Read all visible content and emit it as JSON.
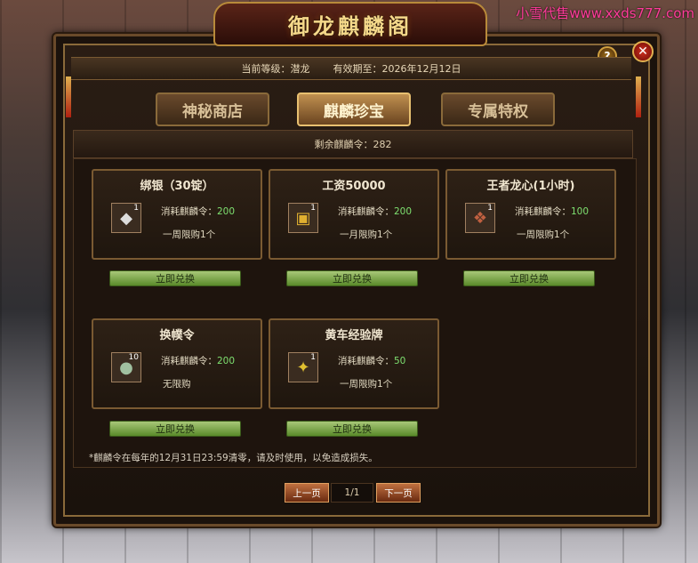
{
  "watermark": "小雪代售www.xxds777.com",
  "window": {
    "title": "御龙麒麟阁",
    "help_label": "?",
    "close_label": "✕",
    "level_label": "当前等级：潜龙",
    "valid_label": "有效期至：2026年12月12日"
  },
  "tabs": [
    {
      "label": "神秘商店",
      "active": false
    },
    {
      "label": "麒麟珍宝",
      "active": true
    },
    {
      "label": "专属特权",
      "active": false
    }
  ],
  "remaining": "剩余麒麟令：282",
  "items": [
    {
      "name": "绑银（30锭）",
      "qty": "1",
      "cost_label": "消耗麒麟令：",
      "cost": "200",
      "limit": "一周限购1个",
      "icon": "silver-ingot-icon",
      "button": "立即兑换"
    },
    {
      "name": "工资50000",
      "qty": "1",
      "cost_label": "消耗麒麟令：",
      "cost": "200",
      "limit": "一月限购1个",
      "icon": "salary-scroll-icon",
      "button": "立即兑换"
    },
    {
      "name": "王者龙心(1小时)",
      "qty": "1",
      "cost_label": "消耗麒麟令：",
      "cost": "100",
      "limit": "一周限购1个",
      "icon": "dragon-heart-icon",
      "button": "立即兑换"
    },
    {
      "name": "换幞令",
      "qty": "10",
      "cost_label": "消耗麒麟令：",
      "cost": "200",
      "limit": "无限购",
      "icon": "exchange-token-icon",
      "button": "立即兑换"
    },
    {
      "name": "黄车经验牌",
      "qty": "1",
      "cost_label": "消耗麒麟令：",
      "cost": "50",
      "limit": "一周限购1个",
      "icon": "yellow-cart-exp-icon",
      "button": "立即兑换"
    }
  ],
  "note": "*麒麟令在每年的12月31日23:59清零，请及时使用，以免造成损失。",
  "pager": {
    "prev": "上一页",
    "page": "1/1",
    "next": "下一页"
  }
}
